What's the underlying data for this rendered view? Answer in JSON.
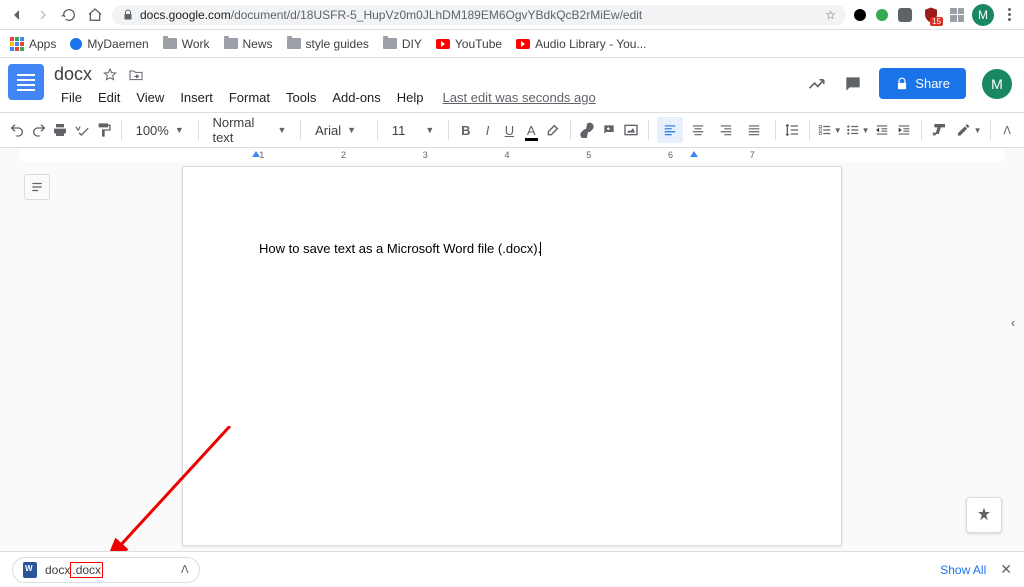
{
  "browser": {
    "url_host": "docs.google.com",
    "url_path": "/document/d/18USFR-5_HupVz0m0JLhDM189EM6OgvYBdkQcB2rMiEw/edit",
    "avatar_letter": "M",
    "ext_shield_badge": "15"
  },
  "bookmarks": {
    "apps": "Apps",
    "items": [
      {
        "label": "MyDaemen",
        "icon": "globe"
      },
      {
        "label": "Work",
        "icon": "folder"
      },
      {
        "label": "News",
        "icon": "folder"
      },
      {
        "label": "style guides",
        "icon": "folder"
      },
      {
        "label": "DIY",
        "icon": "folder"
      },
      {
        "label": "YouTube",
        "icon": "yt"
      },
      {
        "label": "Audio Library - You...",
        "icon": "yt"
      }
    ]
  },
  "doc": {
    "title": "docx",
    "menus": [
      "File",
      "Edit",
      "View",
      "Insert",
      "Format",
      "Tools",
      "Add-ons",
      "Help"
    ],
    "last_edit": "Last edit was seconds ago",
    "share_label": "Share"
  },
  "toolbar": {
    "zoom": "100%",
    "style": "Normal text",
    "font": "Arial",
    "font_size": "11"
  },
  "document_body": "How to save text as a Microsoft Word file (.docx).",
  "download": {
    "file_prefix": "docx",
    "file_suffix": ".docx",
    "show_all": "Show All"
  },
  "ruler_marks": [
    "1",
    "2",
    "3",
    "4",
    "5",
    "6",
    "7"
  ]
}
